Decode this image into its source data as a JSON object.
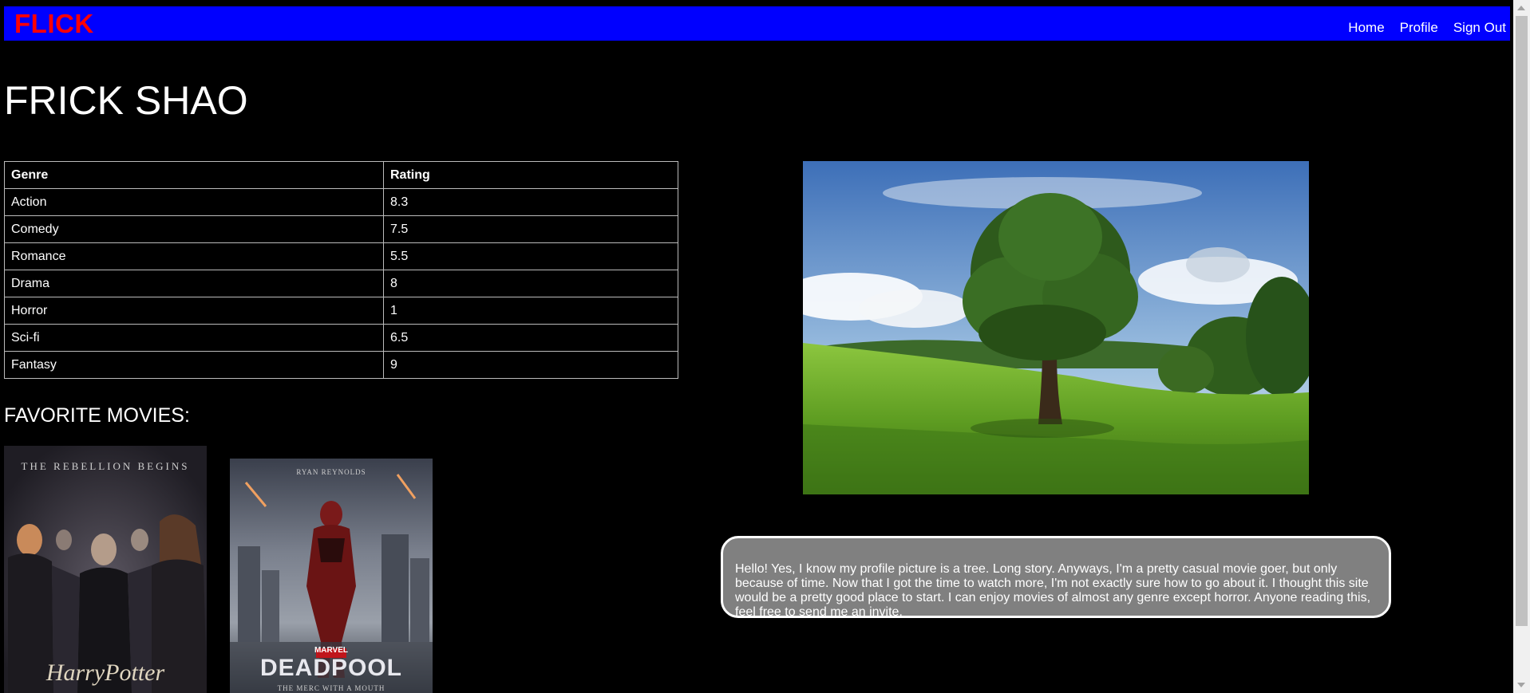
{
  "nav": {
    "brand": "FLICK",
    "links": [
      "Home",
      "Profile",
      "Sign Out"
    ]
  },
  "profile": {
    "name": "FRICK SHAO",
    "bio": "Hello! Yes, I know my profile picture is a tree. Long story. Anyways, I'm a pretty casual movie goer, but only because of time. Now that I got the time to watch more, I'm not exactly sure how to go about it. I thought this site would be a pretty good place to start. I can enjoy movies of almost any genre except horror. Anyone reading this, feel free to send me an invite."
  },
  "ratings": {
    "headers": [
      "Genre",
      "Rating"
    ],
    "rows": [
      [
        "Action",
        "8.3"
      ],
      [
        "Comedy",
        "7.5"
      ],
      [
        "Romance",
        "5.5"
      ],
      [
        "Drama",
        "8"
      ],
      [
        "Horror",
        "1"
      ],
      [
        "Sci-fi",
        "6.5"
      ],
      [
        "Fantasy",
        "9"
      ]
    ]
  },
  "favorites": {
    "heading": "FAVORITE MOVIES:",
    "movies": [
      {
        "tagline": "THE REBELLION BEGINS",
        "title": "HarryPotter"
      },
      {
        "credit": "RYAN REYNOLDS",
        "studio": "MARVEL",
        "title": "DEADPOOL",
        "subtitle": "THE MERC WITH A MOUTH"
      }
    ]
  },
  "colors": {
    "nav_bg": "#0000ff",
    "brand": "#ff0000",
    "page_bg": "#000000",
    "bio_bg": "#808080"
  }
}
